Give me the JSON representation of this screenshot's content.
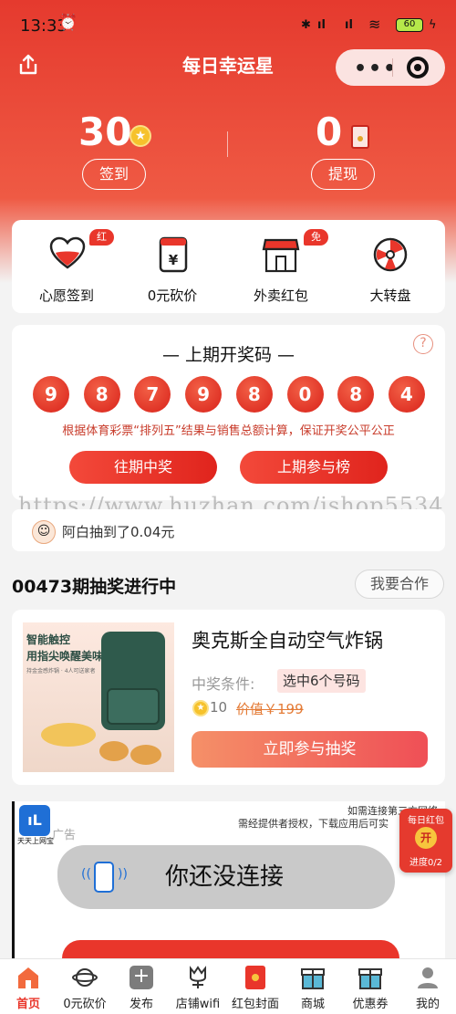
{
  "status_bar": {
    "time": "13:33",
    "battery": "60"
  },
  "header": {
    "title": "每日幸运星"
  },
  "stats": {
    "points": "30",
    "checkin_label": "签到",
    "balance": "0",
    "withdraw_label": "提现"
  },
  "quick_actions": [
    {
      "label": "心愿签到",
      "badge": "红包"
    },
    {
      "label": "0元砍价",
      "badge": ""
    },
    {
      "label": "外卖红包",
      "badge": "免费"
    },
    {
      "label": "大转盘",
      "badge": ""
    }
  ],
  "lottery": {
    "title": "— 上期开奖码 —",
    "numbers": [
      "9",
      "8",
      "7",
      "9",
      "8",
      "0",
      "8",
      "4"
    ],
    "note": "根据体育彩票“排列五”结果与销售总额计算，保证开奖公平公正",
    "btn_past": "往期中奖",
    "btn_rank": "上期参与榜"
  },
  "watermark": "https://www.huzhan.com/ishop5534",
  "ticker": {
    "text": "阿白抽到了0.04元"
  },
  "draw": {
    "heading": "00473期抽奖进行中",
    "cooperate": "我要合作",
    "product": {
      "name": "奥克斯全自动空气炸锅",
      "cond_label": "中奖条件:",
      "cond_value": "选中6个号码",
      "coins": "10",
      "price": "价值￥199",
      "cta": "立即参与抽奖",
      "img_text1": "智能触控",
      "img_text2": "用指尖唤醒美味",
      "img_text3": "持金金感炸锅 · 4人可送家者"
    }
  },
  "ad": {
    "notice1": "如需连接第三方网络",
    "notice2": "需经提供者授权，下载应用后可实",
    "label": "广告",
    "app": "天天上网宝",
    "message": "你还没连接"
  },
  "floating": {
    "title": "每日红包",
    "open": "开",
    "progress": "进度0/2"
  },
  "tabs": [
    {
      "label": "首页",
      "active": true
    },
    {
      "label": "0元砍价"
    },
    {
      "label": "发布"
    },
    {
      "label": "店铺wifi"
    },
    {
      "label": "红包封面"
    },
    {
      "label": "商城"
    },
    {
      "label": "优惠券"
    },
    {
      "label": "我的"
    }
  ],
  "colors": {
    "brand_red": "#e53a2e",
    "accent_orange": "#f0765a"
  }
}
